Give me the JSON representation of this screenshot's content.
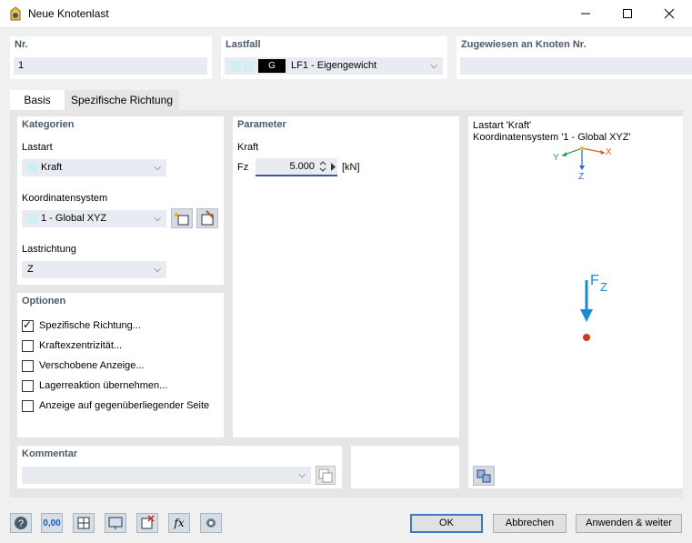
{
  "window": {
    "title": "Neue Knotenlast"
  },
  "header": {
    "nr_label": "Nr.",
    "nr_value": "1",
    "lastfall_label": "Lastfall",
    "lastfall_badge": "G",
    "lastfall_value": "LF1 - Eigengewicht",
    "assigned_label": "Zugewiesen an Knoten Nr.",
    "assigned_value": ""
  },
  "tabs": [
    {
      "label": "Basis",
      "active": true
    },
    {
      "label": "Spezifische Richtung",
      "active": false
    }
  ],
  "kategorien": {
    "title": "Kategorien",
    "lastart_label": "Lastart",
    "lastart_value": "Kraft",
    "koord_label": "Koordinatensystem",
    "koord_value": "1 - Global XYZ",
    "richtung_label": "Lastrichtung",
    "richtung_value": "Z"
  },
  "parameter": {
    "title": "Parameter",
    "kraft_label": "Kraft",
    "fz_label": "Fz",
    "fz_value": "5.000",
    "fz_unit": "[kN]"
  },
  "optionen": {
    "title": "Optionen",
    "items": [
      {
        "label": "Spezifische Richtung...",
        "checked": true
      },
      {
        "label": "Kraftexzentrizität...",
        "checked": false
      },
      {
        "label": "Verschobene Anzeige...",
        "checked": false
      },
      {
        "label": "Lagerreaktion übernehmen...",
        "checked": false
      },
      {
        "label": "Anzeige auf gegenüberliegender Seite",
        "checked": false
      }
    ]
  },
  "preview": {
    "line1": "Lastart 'Kraft'",
    "line2": "Koordinatensystem '1 - Global XYZ'",
    "axis_x": "X",
    "axis_y": "Y",
    "axis_z": "Z",
    "force_label": "F",
    "force_sub": "Z"
  },
  "kommentar": {
    "title": "Kommentar",
    "value": ""
  },
  "buttons": {
    "ok": "OK",
    "cancel": "Abbrechen",
    "apply": "Anwenden & weiter"
  },
  "toolbar": {
    "value_icon_text": "0,00"
  },
  "colors": {
    "accent": "#1a8ad4",
    "force": "#1a8ad4",
    "point": "#d23a1a",
    "x_axis": "#e05a2a",
    "y_axis": "#2a9a4a",
    "z_axis": "#2a6ac8"
  }
}
